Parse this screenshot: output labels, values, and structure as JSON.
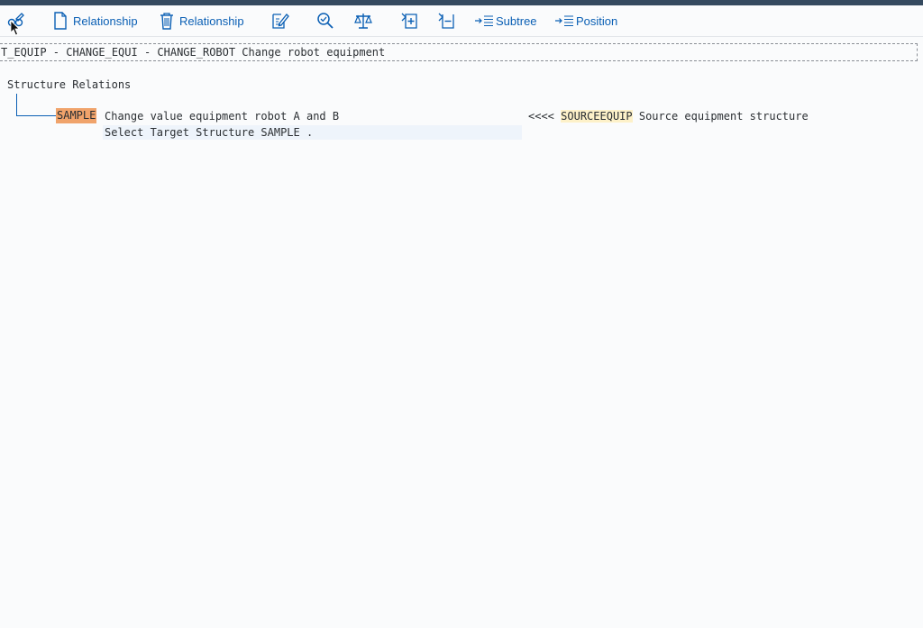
{
  "toolbar": {
    "create_relationship_label": "Relationship",
    "delete_relationship_label": "Relationship",
    "subtree_label": "Subtree",
    "position_label": "Position",
    "icons": {
      "edit": "edit-glasses-icon",
      "create_relationship": "new-document-icon",
      "delete_relationship": "trash-icon",
      "change": "edit-pencil-icon",
      "check": "check-magnifier-icon",
      "compare": "balance-scale-icon",
      "expand": "expand-plus-icon",
      "collapse": "collapse-minus-icon",
      "subtree": "arrow-list-icon",
      "position": "arrow-list-icon"
    }
  },
  "header_path": "T_EQUIP - CHANGE_EQUI - CHANGE_ROBOT Change robot equipment",
  "section_title": "Structure Relations",
  "relation": {
    "target_name": "SAMPLE",
    "target_description": "Change value equipment robot A and B",
    "arrow": "<<<<",
    "source_name": "SOURCEEQUIP",
    "source_description": "Source equipment structure",
    "select_text": "Select Target Structure SAMPLE ."
  },
  "colors": {
    "accent": "#0a6ed1",
    "target_highlight": "#f0a36b",
    "source_highlight": "#fdf1c9",
    "shell_bar": "#354a5f"
  }
}
